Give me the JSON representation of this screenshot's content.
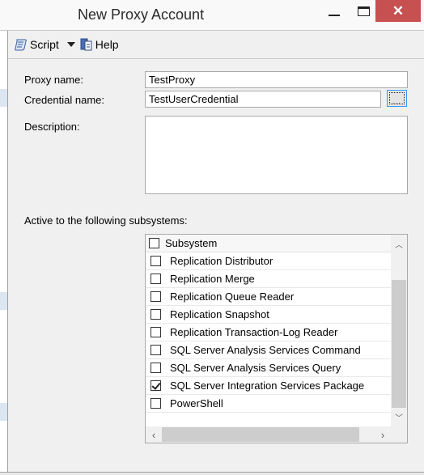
{
  "window": {
    "title": "New Proxy Account",
    "minimize_label": "minimize",
    "maximize_label": "maximize",
    "close_glyph": "✕"
  },
  "toolbar": {
    "script_label": "Script",
    "script_icon": "script-scroll-icon",
    "help_label": "Help",
    "help_icon": "help-document-icon"
  },
  "form": {
    "proxy_name_label": "Proxy name:",
    "proxy_name_value": "TestProxy",
    "credential_name_label": "Credential name:",
    "credential_name_value": "TestUserCredential",
    "browse_label": "...",
    "description_label": "Description:",
    "description_value": "",
    "subsystems_label": "Active to the following subsystems:"
  },
  "subsystems": {
    "header": "Subsystem",
    "header_checked": false,
    "items": [
      {
        "label": "Replication Distributor",
        "checked": false
      },
      {
        "label": "Replication Merge",
        "checked": false
      },
      {
        "label": "Replication Queue Reader",
        "checked": false
      },
      {
        "label": "Replication Snapshot",
        "checked": false
      },
      {
        "label": "Replication Transaction-Log Reader",
        "checked": false
      },
      {
        "label": "SQL Server Analysis Services Command",
        "checked": false
      },
      {
        "label": "SQL Server Analysis Services Query",
        "checked": false
      },
      {
        "label": "SQL Server Integration Services Package",
        "checked": true
      },
      {
        "label": "PowerShell",
        "checked": false
      }
    ]
  },
  "colors": {
    "close_button": "#c75050",
    "panel_bg": "#f0f0f0",
    "focus_border": "#3399ff"
  }
}
